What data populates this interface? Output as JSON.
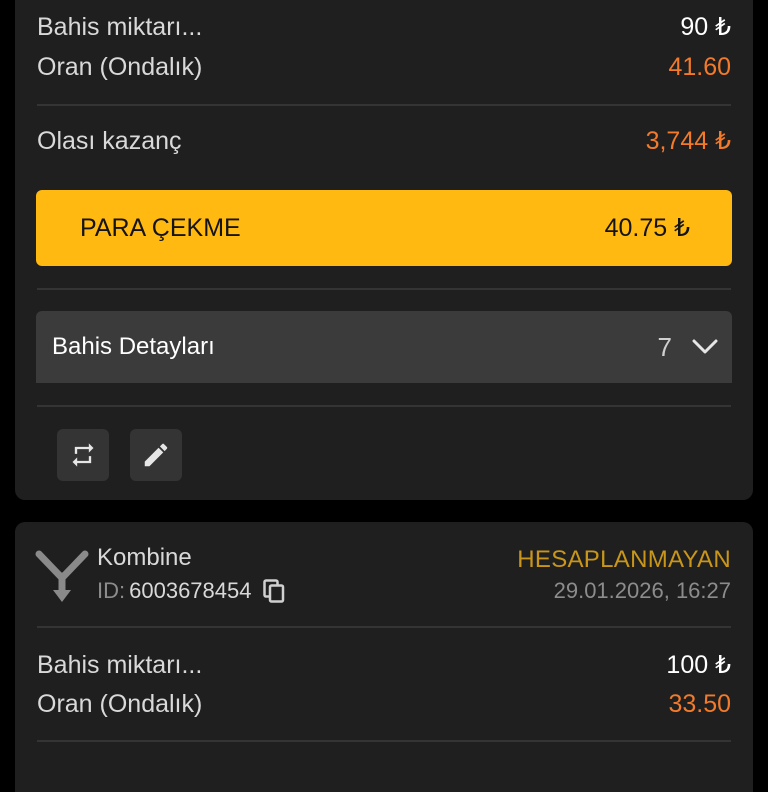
{
  "card1": {
    "stake_label": "Bahis miktarı...",
    "stake_value": "90 ₺",
    "odds_label": "Oran (Ondalık)",
    "odds_value": "41.60",
    "potential_label": "Olası kazanç",
    "potential_value": "3,744 ₺",
    "cashout": {
      "label": "PARA ÇEKME",
      "amount": "40.75 ₺"
    },
    "details": {
      "label": "Bahis Detayları",
      "count": "7"
    },
    "actions": [
      {
        "icon": "repeat-icon"
      },
      {
        "icon": "edit-pencil-icon"
      }
    ]
  },
  "card2": {
    "bet_type": "Kombine",
    "id_label": "ID:",
    "id_value": "6003678454",
    "status": "HESAPLANMAYAN",
    "datetime": "29.01.2026, 16:27",
    "stake_label": "Bahis miktarı...",
    "stake_value": "100 ₺",
    "odds_label": "Oran (Ondalık)",
    "odds_value": "33.50"
  },
  "colors": {
    "background": "#000000",
    "card": "#1f1f1f",
    "accent_yellow": "#ffb910",
    "orange_value": "#f27a2a",
    "status_gold": "#c9961a"
  }
}
